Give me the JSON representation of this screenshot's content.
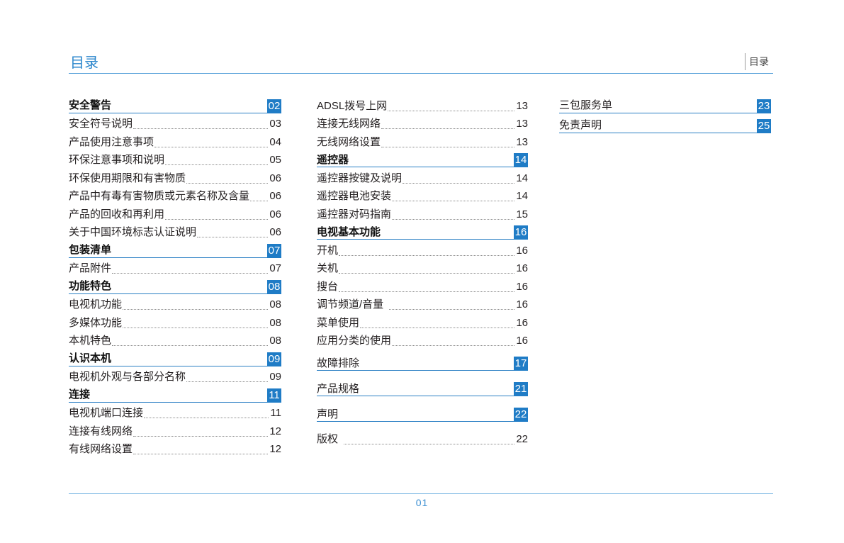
{
  "header": {
    "title": "目录",
    "tab_label": "目录"
  },
  "colors": {
    "accent": "#1f7cc6",
    "header_text": "#2b86cc",
    "rule": "#4f9dd8"
  },
  "columns": [
    {
      "entries": [
        {
          "label": "安全警告",
          "page": "02"
        },
        {
          "label": "安全符号说明",
          "page": "03"
        },
        {
          "label": "产品使用注意事项",
          "page": "04"
        },
        {
          "label": "环保注意事项和说明",
          "page": "05"
        },
        {
          "label": "环保使用期限和有害物质",
          "page": "06"
        },
        {
          "label": "产品中有毒有害物质或元素名称及含量",
          "page": "06"
        },
        {
          "label": "产品的回收和再利用",
          "page": "06"
        },
        {
          "label": "关于中国环境标志认证说明",
          "page": "06"
        },
        {
          "label": "包装清单",
          "page": "07"
        },
        {
          "label": "产品附件",
          "page": "07"
        },
        {
          "label": "功能特色",
          "page": "08"
        },
        {
          "label": "电视机功能",
          "page": "08"
        },
        {
          "label": "多媒体功能",
          "page": "08"
        },
        {
          "label": "本机特色",
          "page": "08"
        },
        {
          "label": "认识本机",
          "page": "09"
        },
        {
          "label": "电视机外观与各部分名称",
          "page": "09"
        },
        {
          "label": "连接",
          "page": "11"
        },
        {
          "label": "电视机端口连接",
          "page": "11"
        },
        {
          "label": "连接有线网络",
          "page": "12"
        },
        {
          "label": "有线网络设置",
          "page": "12"
        }
      ]
    },
    {
      "entries": [
        {
          "label": "ADSL拨号上网",
          "page": "13"
        },
        {
          "label": "连接无线网络",
          "page": "13"
        },
        {
          "label": "无线网络设置",
          "page": "13"
        },
        {
          "label": "遥控器",
          "page": "14"
        },
        {
          "label": "遥控器按键及说明",
          "page": "14"
        },
        {
          "label": "遥控器电池安装",
          "page": "14"
        },
        {
          "label": "遥控器对码指南",
          "page": "15"
        },
        {
          "label": "电视基本功能",
          "page": "16"
        },
        {
          "label": "开机",
          "page": "16"
        },
        {
          "label": "关机",
          "page": "16"
        },
        {
          "label": "搜台",
          "page": "16"
        },
        {
          "label": "调节频道/音量",
          "page": "16"
        },
        {
          "label": "菜单使用",
          "page": "16"
        },
        {
          "label": "应用分类的使用",
          "page": "16"
        },
        {
          "label": "故障排除",
          "page": "17"
        },
        {
          "label": "产品规格",
          "page": "21"
        },
        {
          "label": "声明",
          "page": "22"
        },
        {
          "label": "版权",
          "page": "22"
        }
      ]
    },
    {
      "entries": [
        {
          "label": "三包服务单",
          "page": "23"
        },
        {
          "label": "免责声明",
          "page": "25"
        }
      ]
    }
  ],
  "footer": {
    "page_number": "01"
  }
}
